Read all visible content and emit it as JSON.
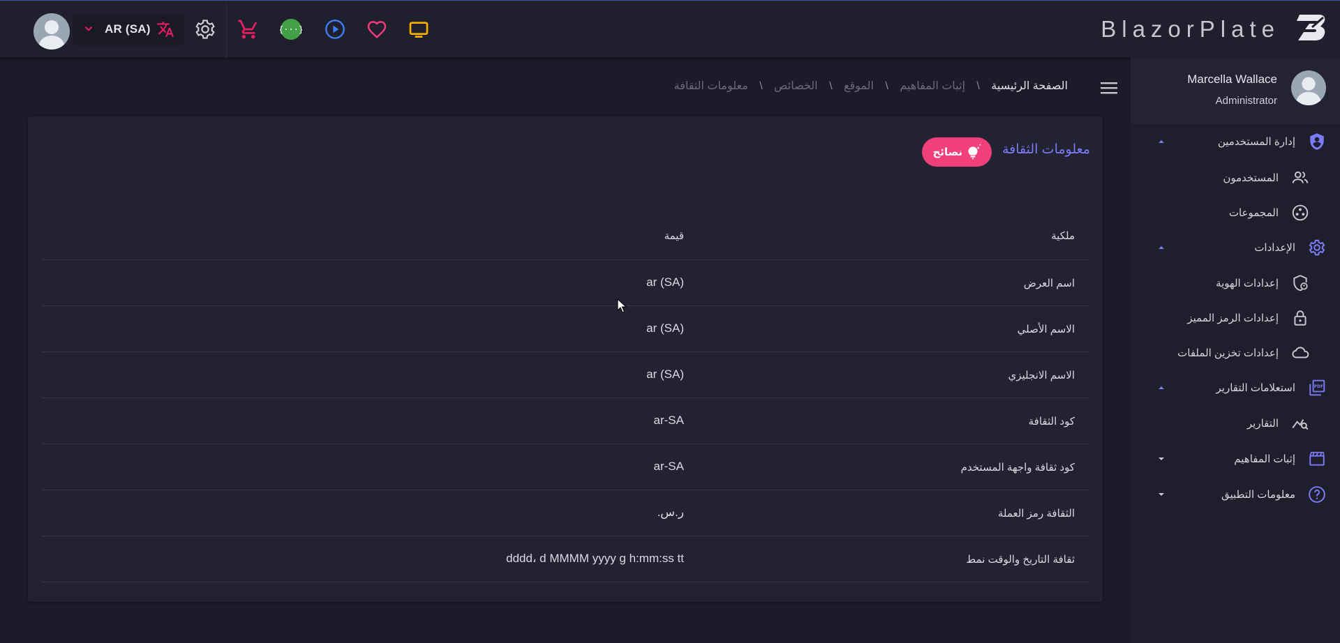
{
  "topbar": {
    "language_label": "AR (SA)",
    "icons": [
      "avatar",
      "chevron-down-icon",
      "translate-icon",
      "settings-icon",
      "cart-icon",
      "api-icon",
      "play-icon",
      "heart-icon",
      "monitor-icon"
    ],
    "brand_name": "BlazorPlate",
    "colors": {
      "cart": "#e91e63",
      "api": "#43a047",
      "play": "#3d7ff7",
      "heart": "#f03c78",
      "monitor": "#ffb300",
      "translate": "#e91e63"
    }
  },
  "sidebar": {
    "user_name": "Marcella Wallace",
    "user_role": "Administrator",
    "items": [
      {
        "label": "إدارة المستخدمين",
        "icon": "shield-icon",
        "level": 0,
        "expanded": true
      },
      {
        "label": "المستخدمون",
        "icon": "users-icon",
        "level": 1
      },
      {
        "label": "المجموعات",
        "icon": "groups-icon",
        "level": 1
      },
      {
        "label": "الإعدادات",
        "icon": "gear-icon",
        "level": 0,
        "expanded": true
      },
      {
        "label": "إعدادات الهوية",
        "icon": "identity-shield-icon",
        "level": 1
      },
      {
        "label": "إعدادات الرمز المميز",
        "icon": "lock-icon",
        "level": 1
      },
      {
        "label": "إعدادات تخزين الملفات",
        "icon": "cloud-icon",
        "level": 1
      },
      {
        "label": "استعلامات التقارير",
        "icon": "pdf-icon",
        "level": 0,
        "expanded": true
      },
      {
        "label": "التقارير",
        "icon": "chart-search-icon",
        "level": 1
      },
      {
        "label": "إثبات المفاهيم",
        "icon": "clapper-icon",
        "level": 0,
        "expanded": false
      },
      {
        "label": "معلومات التطبيق",
        "icon": "help-icon",
        "level": 0,
        "expanded": false
      }
    ],
    "accent": "#7b7bf5"
  },
  "breadcrumb": [
    "الصفحة الرئيسية",
    "إثبات المفاهيم",
    "الموقع",
    "الخصائص",
    "معلومات الثقافة"
  ],
  "breadcrumb_separator": "\\",
  "card": {
    "title": "معلومات الثقافة",
    "tips_label": "نصائح",
    "tips_color": "#f0407a",
    "columns": {
      "property": "ملكية",
      "value": "قيمة"
    },
    "rows": [
      {
        "property": "اسم العرض",
        "value": "ar (SA)"
      },
      {
        "property": "الاسم الأصلي",
        "value": "ar (SA)"
      },
      {
        "property": "الاسم الانجليزي",
        "value": "ar (SA)"
      },
      {
        "property": "كود الثقافة",
        "value": "ar-SA"
      },
      {
        "property": "كود ثقافة واجهة المستخدم",
        "value": "ar-SA"
      },
      {
        "property": "الثقافة رمز العملة",
        "value": "ر.س.‏"
      },
      {
        "property": "ثقافة التاريخ والوقت نمط",
        "value": "dddd، d MMMM yyyy g h:mm:ss tt"
      }
    ]
  }
}
